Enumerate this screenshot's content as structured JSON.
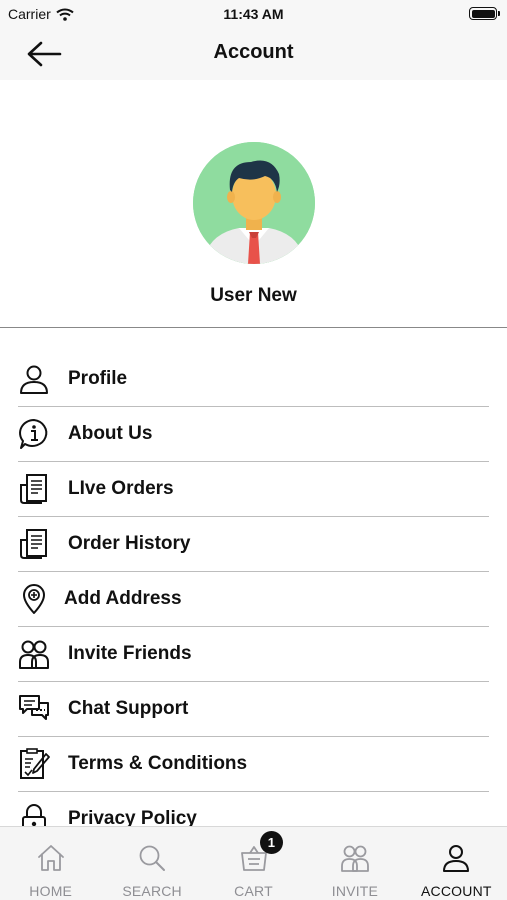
{
  "status_bar": {
    "carrier": "Carrier",
    "time": "11:43 AM"
  },
  "nav": {
    "title": "Account",
    "back_icon": "arrow-left-icon"
  },
  "profile": {
    "name": "User New",
    "avatar_icon": "user-avatar-illustration"
  },
  "menu": [
    {
      "label": "Profile",
      "icon": "person-icon"
    },
    {
      "label": "About Us",
      "icon": "info-bubble-icon"
    },
    {
      "label": "LIve Orders",
      "icon": "receipt-icon"
    },
    {
      "label": "Order History",
      "icon": "receipt-icon"
    },
    {
      "label": "Add Address",
      "icon": "location-pin-icon"
    },
    {
      "label": "Invite Friends",
      "icon": "group-icon"
    },
    {
      "label": "Chat Support",
      "icon": "chat-icon"
    },
    {
      "label": "Terms & Conditions",
      "icon": "document-edit-icon"
    },
    {
      "label": "Privacy Policy",
      "icon": "lock-icon"
    }
  ],
  "tabs": [
    {
      "label": "HOME",
      "icon": "home-icon",
      "active": false
    },
    {
      "label": "SEARCH",
      "icon": "search-icon",
      "active": false
    },
    {
      "label": "CART",
      "icon": "basket-icon",
      "active": false,
      "badge": "1"
    },
    {
      "label": "INVITE",
      "icon": "group-icon",
      "active": false
    },
    {
      "label": "ACCOUNT",
      "icon": "person-icon",
      "active": true
    }
  ],
  "colors": {
    "avatar_bg": "#8fdc9f",
    "active_tab": "#111111",
    "inactive_tab": "#8e8e93",
    "badge_bg": "#111111"
  }
}
